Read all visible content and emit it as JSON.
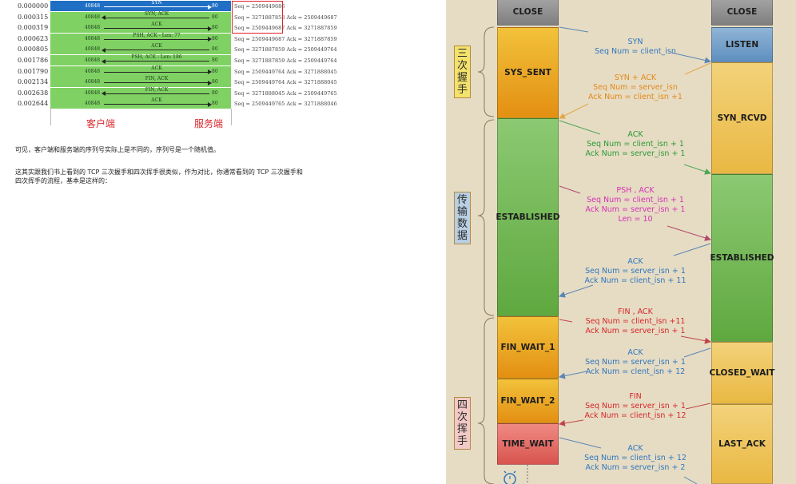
{
  "capture": {
    "rows": [
      {
        "time": "0.000000",
        "client_port": "40848",
        "server_port": "80",
        "label": "SYN",
        "dir": "right",
        "info": "Seq = 2509449686",
        "selected": true
      },
      {
        "time": "0.000315",
        "client_port": "40848",
        "server_port": "80",
        "label": "SYN, ACK",
        "dir": "left",
        "info": "Seq = 3271887858 Ack = 2509449687",
        "selected": false
      },
      {
        "time": "0.000319",
        "client_port": "40848",
        "server_port": "80",
        "label": "ACK",
        "dir": "right",
        "info": "Seq = 2509449687 Ack = 3271887859",
        "selected": false
      },
      {
        "time": "0.000623",
        "client_port": "40848",
        "server_port": "80",
        "label": "PSH, ACK - Len: 77",
        "dir": "right",
        "info": "Seq = 2509449687 Ack = 3271887859",
        "selected": false
      },
      {
        "time": "0.000805",
        "client_port": "40848",
        "server_port": "80",
        "label": "ACK",
        "dir": "left",
        "info": "Seq = 3271887859 Ack = 2509449764",
        "selected": false
      },
      {
        "time": "0.001786",
        "client_port": "40848",
        "server_port": "80",
        "label": "PSH, ACK - Len: 186",
        "dir": "left",
        "info": "Seq = 3271887859 Ack = 2509449764",
        "selected": false
      },
      {
        "time": "0.001790",
        "client_port": "40848",
        "server_port": "80",
        "label": "ACK",
        "dir": "right",
        "info": "Seq = 2509449764 Ack = 3271888045",
        "selected": false
      },
      {
        "time": "0.002134",
        "client_port": "40848",
        "server_port": "80",
        "label": "FIN, ACK",
        "dir": "right",
        "info": "Seq = 2509449764 Ack = 3271888045",
        "selected": false
      },
      {
        "time": "0.002638",
        "client_port": "40848",
        "server_port": "80",
        "label": "FIN, ACK",
        "dir": "left",
        "info": "Seq = 3271888045 Ack = 2509449765",
        "selected": false
      },
      {
        "time": "0.002644",
        "client_port": "40848",
        "server_port": "80",
        "label": "ACK",
        "dir": "right",
        "info": "Seq = 2509449765 Ack = 3271888046",
        "selected": false
      }
    ],
    "client_label": "客户端",
    "server_label": "服务端"
  },
  "text": {
    "p1": "可见，客户端和服务端的序列号实际上是不同的，序列号是一个随机值。",
    "p2a": "这其实跟我们书上看到的 TCP 三次握手和四次挥手很类似，作为对比，你通常看到的 TCP 三次握手和",
    "p2b": "四次挥手的流程，基本是这样的："
  },
  "diagram": {
    "phases": {
      "handshake": [
        "三",
        "次",
        "握",
        "手"
      ],
      "transfer": [
        "传",
        "输",
        "数",
        "据"
      ],
      "wave": [
        "四",
        "次",
        "挥",
        "手"
      ]
    },
    "client_states": {
      "close": "CLOSE",
      "syn_sent": "SYS_SENT",
      "established": "ESTABLISHED",
      "fin_wait_1": "FIN_WAIT_1",
      "fin_wait_2": "FIN_WAIT_2",
      "time_wait": "TIME_WAIT"
    },
    "server_states": {
      "close": "CLOSE",
      "listen": "LISTEN",
      "syn_rcvd": "SYN_RCVD",
      "established": "ESTABLISHED",
      "close_wait": "CLOSED_WAIT",
      "last_ack": "LAST_ACK"
    },
    "messages": [
      {
        "lines": [
          "SYN",
          "Seq Num = client_isn"
        ],
        "color": "blue"
      },
      {
        "lines": [
          "SYN + ACK",
          "Seq Num = server_isn",
          "Ack Num =  client_isn +1"
        ],
        "color": "orange"
      },
      {
        "lines": [
          "ACK",
          "Seq Num = client_isn + 1",
          "Ack Num = server_isn + 1"
        ],
        "color": "green"
      },
      {
        "lines": [
          "PSH , ACK",
          "Seq Num = client_isn + 1",
          "Ack Num = server_isn + 1",
          "Len = 10"
        ],
        "color": "magenta"
      },
      {
        "lines": [
          "ACK",
          "Seq Num = server_isn + 1",
          "Ack Num = client_isn + 11"
        ],
        "color": "blue"
      },
      {
        "lines": [
          "FIN , ACK",
          "Seq Num = client_isn +11",
          "Ack Num = server_isn + 1"
        ],
        "color": "red"
      },
      {
        "lines": [
          "ACK",
          "Seq Num = server_isn + 1",
          "Ack Num = clent_isn + 12"
        ],
        "color": "blue"
      },
      {
        "lines": [
          "FIN",
          "Seq Num = server_isn + 1",
          "Ack Num = client_isn + 12"
        ],
        "color": "red"
      },
      {
        "lines": [
          "ACK",
          "Seq Num = client_isn + 12",
          "Ack Num = server_isn + 2"
        ],
        "color": "blue"
      }
    ],
    "colors": {
      "blue": "#2f76c0",
      "orange": "#e2881a",
      "green": "#2a9a36",
      "magenta": "#d531b5",
      "red": "#d7262b"
    }
  }
}
